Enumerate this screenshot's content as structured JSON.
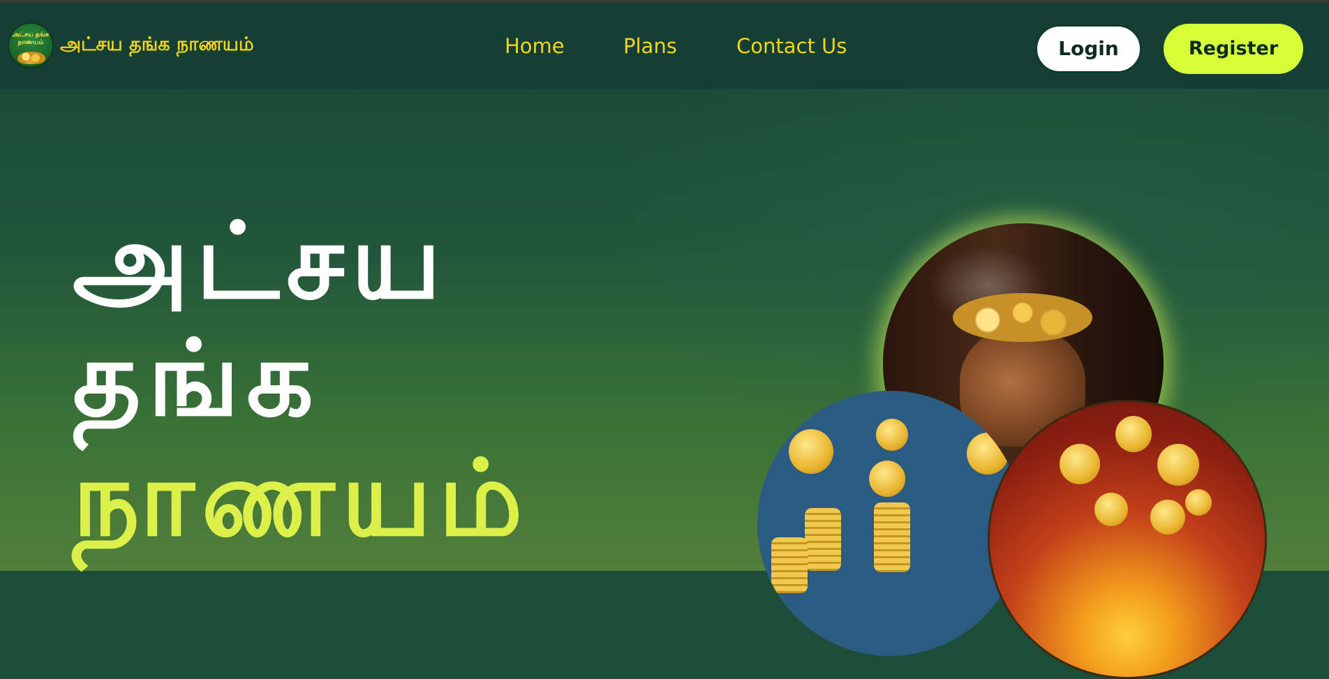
{
  "header": {
    "logo_text": "அட்சய தங்க நாணயம்",
    "brand": "அட்சய தங்க நாணயம்",
    "nav": [
      {
        "label": "Home"
      },
      {
        "label": "Plans"
      },
      {
        "label": "Contact Us"
      }
    ],
    "login_label": "Login",
    "register_label": "Register"
  },
  "hero": {
    "line1": "அட்சய",
    "line2": "தங்க",
    "line3": "நாணயம்"
  },
  "colors": {
    "nav_bg": "#153f34",
    "nav_text": "#f2d51b",
    "accent": "#d6ff3a",
    "highlight_text": "#ddf04a"
  }
}
